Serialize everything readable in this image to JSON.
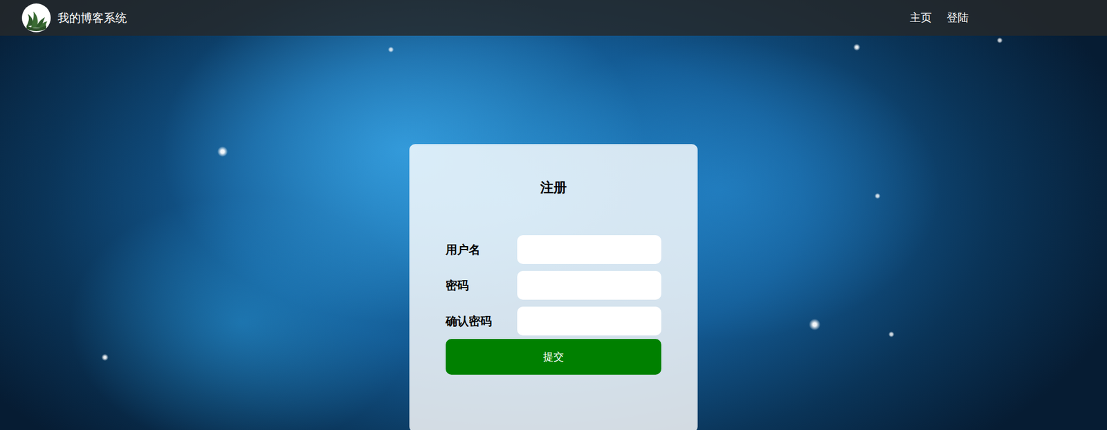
{
  "window": {
    "title": "我的博客系统"
  },
  "nav": {
    "links": [
      {
        "label": "主页"
      },
      {
        "label": "登陆"
      }
    ]
  },
  "form": {
    "title": "注册",
    "fields": [
      {
        "label": "用户名",
        "value": ""
      },
      {
        "label": "密码",
        "value": ""
      },
      {
        "label": "确认密码",
        "value": ""
      }
    ],
    "submit": "提交"
  }
}
